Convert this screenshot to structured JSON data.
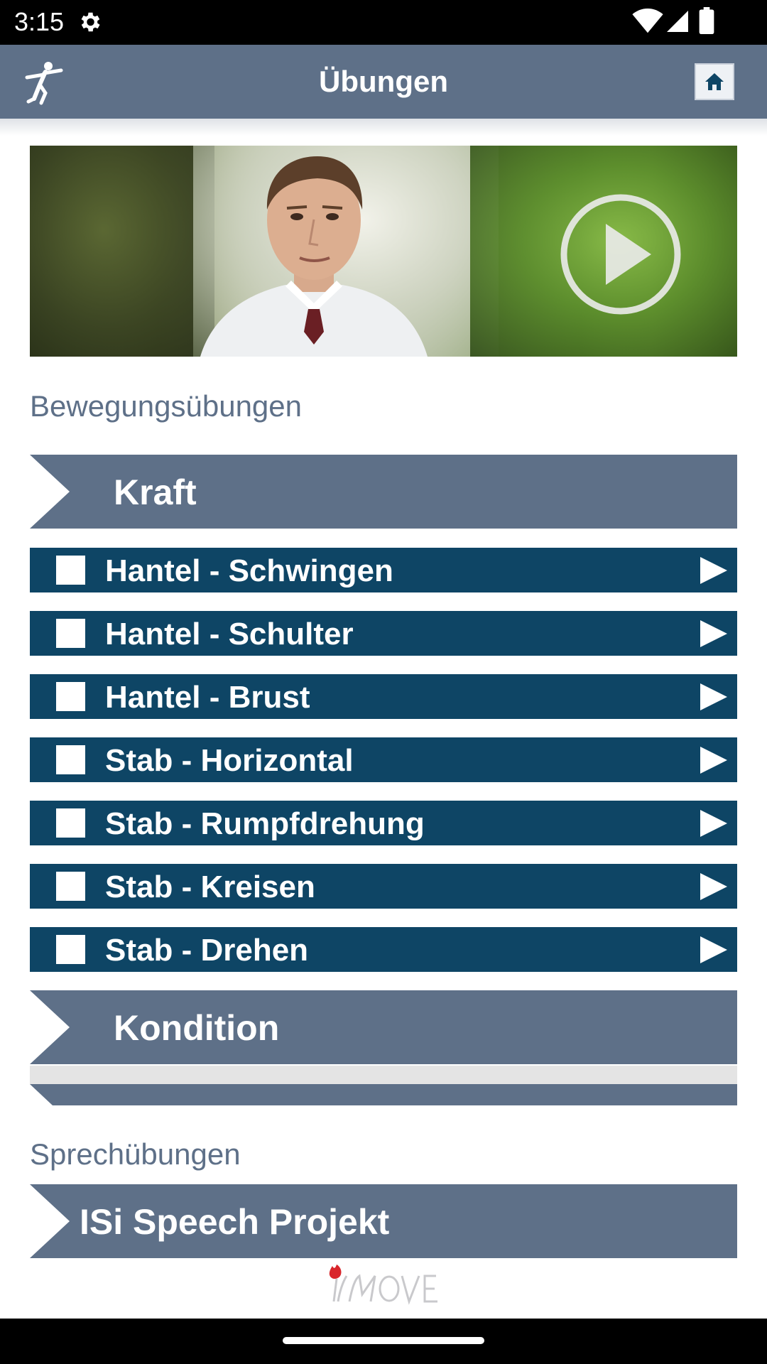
{
  "status_bar": {
    "time": "3:15",
    "icons": [
      "gear-icon",
      "wifi-icon",
      "signal-icon",
      "battery-icon"
    ]
  },
  "app_bar": {
    "title": "Übungen",
    "logo_icon": "running-person-icon",
    "home_icon": "home-icon"
  },
  "banner": {
    "play_icon": "play-circle-icon"
  },
  "sections": {
    "movement_heading": "Bewegungsübungen",
    "speech_heading": "Sprechübungen"
  },
  "categories": {
    "kraft": "Kraft",
    "kondition": "Kondition",
    "speech": "ISi Speech Projekt"
  },
  "exercises": [
    {
      "label": "Hantel - Schwingen",
      "checked": false
    },
    {
      "label": "Hantel - Schulter",
      "checked": false
    },
    {
      "label": "Hantel - Brust",
      "checked": false
    },
    {
      "label": "Stab - Horizontal",
      "checked": false
    },
    {
      "label": "Stab - Rumpfdrehung",
      "checked": false
    },
    {
      "label": "Stab - Kreisen",
      "checked": false
    },
    {
      "label": "Stab - Drehen",
      "checked": false
    }
  ],
  "footer": {
    "logo_icon": "imove-logo"
  },
  "colors": {
    "app_bar": "#5e7088",
    "category_bar": "#5e7088",
    "exercise_row": "#0e4565",
    "heading_text": "#5e7088"
  }
}
